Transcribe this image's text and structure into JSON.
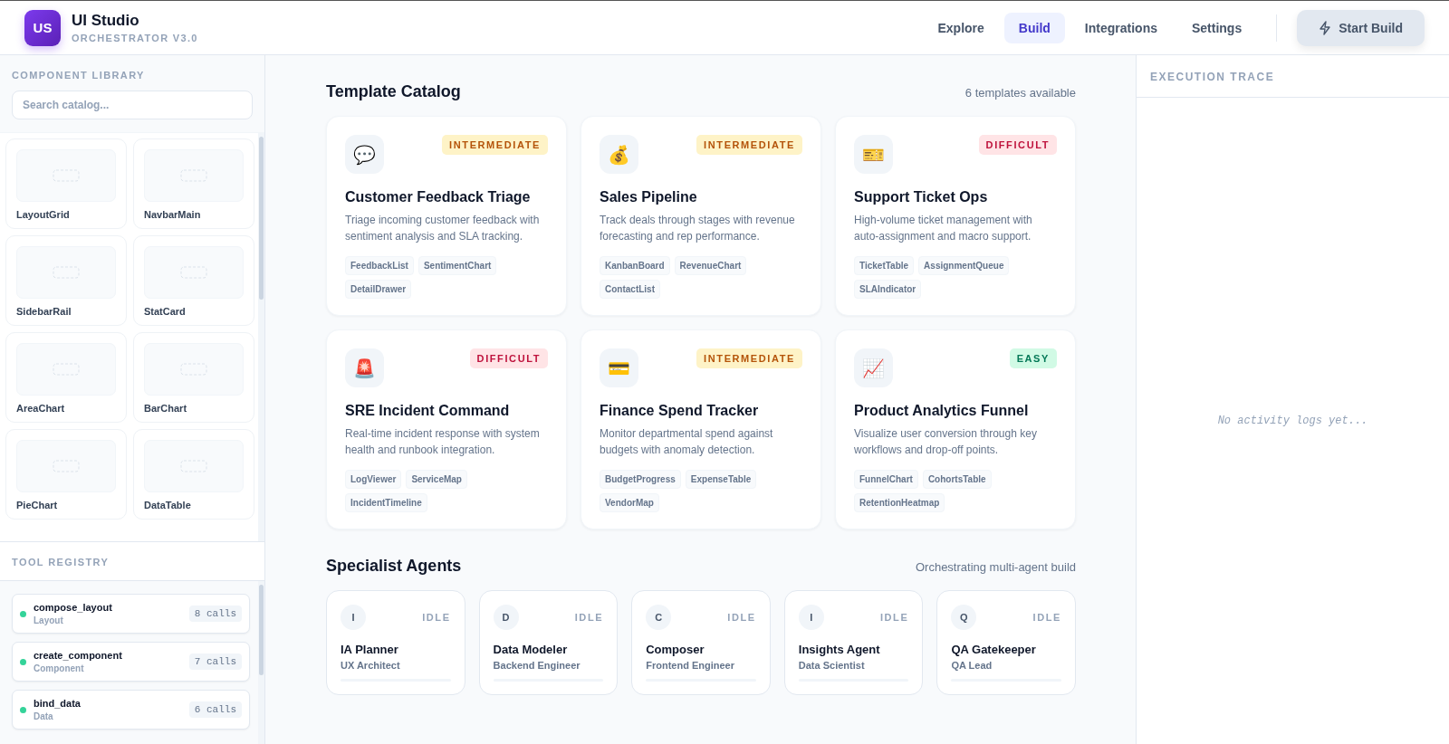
{
  "app": {
    "logo": "US",
    "title": "UI Studio",
    "subtitle": "ORCHESTRATOR V3.0"
  },
  "nav": [
    {
      "label": "Explore",
      "selected": false
    },
    {
      "label": "Build",
      "selected": true
    },
    {
      "label": "Integrations",
      "selected": false
    },
    {
      "label": "Settings",
      "selected": false
    }
  ],
  "start_button": {
    "label": "Start Build"
  },
  "component_library": {
    "title": "COMPONENT LIBRARY",
    "search": {
      "placeholder": "Search catalog..."
    },
    "items": [
      "LayoutGrid",
      "NavbarMain",
      "SidebarRail",
      "StatCard",
      "AreaChart",
      "BarChart",
      "PieChart",
      "DataTable"
    ]
  },
  "tool_registry": {
    "title": "TOOL REGISTRY",
    "tools": [
      {
        "name": "compose_layout",
        "category": "Layout",
        "calls": "8 calls"
      },
      {
        "name": "create_component",
        "category": "Component",
        "calls": "7 calls"
      },
      {
        "name": "bind_data",
        "category": "Data",
        "calls": "6 calls"
      }
    ]
  },
  "template_catalog": {
    "title": "Template Catalog",
    "count": "6 templates available",
    "templates": [
      {
        "icon": "💬",
        "difficulty": "INTERMEDIATE",
        "kind": "intermediate",
        "title": "Customer Feedback Triage",
        "description": "Triage incoming customer feedback with sentiment analysis and SLA tracking.",
        "tags": [
          "FeedbackList",
          "SentimentChart",
          "DetailDrawer"
        ]
      },
      {
        "icon": "💰",
        "difficulty": "INTERMEDIATE",
        "kind": "intermediate",
        "title": "Sales Pipeline",
        "description": "Track deals through stages with revenue forecasting and rep performance.",
        "tags": [
          "KanbanBoard",
          "RevenueChart",
          "ContactList"
        ]
      },
      {
        "icon": "🎫",
        "difficulty": "DIFFICULT",
        "kind": "difficult",
        "title": "Support Ticket Ops",
        "description": "High-volume ticket management with auto-assignment and macro support.",
        "tags": [
          "TicketTable",
          "AssignmentQueue",
          "SLAIndicator"
        ]
      },
      {
        "icon": "🚨",
        "difficulty": "DIFFICULT",
        "kind": "difficult",
        "title": "SRE Incident Command",
        "description": "Real-time incident response with system health and runbook integration.",
        "tags": [
          "LogViewer",
          "ServiceMap",
          "IncidentTimeline"
        ]
      },
      {
        "icon": "💳",
        "difficulty": "INTERMEDIATE",
        "kind": "intermediate",
        "title": "Finance Spend Tracker",
        "description": "Monitor departmental spend against budgets with anomaly detection.",
        "tags": [
          "BudgetProgress",
          "ExpenseTable",
          "VendorMap"
        ]
      },
      {
        "icon": "📈",
        "difficulty": "EASY",
        "kind": "easy",
        "title": "Product Analytics Funnel",
        "description": "Visualize user conversion through key workflows and drop-off points.",
        "tags": [
          "FunnelChart",
          "CohortsTable",
          "RetentionHeatmap"
        ]
      }
    ]
  },
  "specialist_agents": {
    "title": "Specialist Agents",
    "subtitle": "Orchestrating multi-agent build",
    "agents": [
      {
        "initial": "I",
        "status": "IDLE",
        "name": "IA Planner",
        "role": "UX Architect",
        "level": 0
      },
      {
        "initial": "D",
        "status": "IDLE",
        "name": "Data Modeler",
        "role": "Backend Engineer",
        "level": 0
      },
      {
        "initial": "C",
        "status": "IDLE",
        "name": "Composer",
        "role": "Frontend Engineer",
        "level": 0
      },
      {
        "initial": "I",
        "status": "IDLE",
        "name": "Insights Agent",
        "role": "Data Scientist",
        "level": 0
      },
      {
        "initial": "Q",
        "status": "IDLE",
        "name": "QA Gatekeeper",
        "role": "QA Lead",
        "level": 0
      }
    ]
  },
  "execution_trace": {
    "title": "EXECUTION TRACE",
    "empty_message": "No activity logs yet..."
  }
}
